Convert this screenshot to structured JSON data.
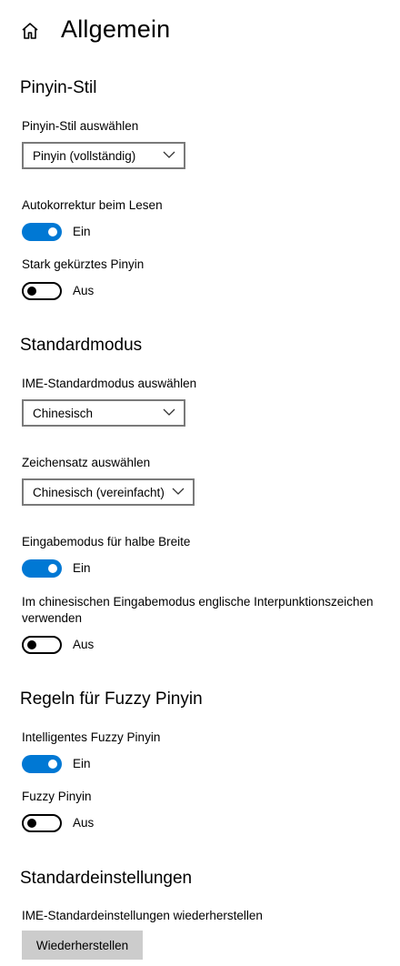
{
  "header": {
    "title": "Allgemein"
  },
  "sections": {
    "pinyin": {
      "heading": "Pinyin-Stil",
      "select_label": "Pinyin-Stil auswählen",
      "select_value": "Pinyin (vollständig)",
      "autocorrect_label": "Autokorrektur beim Lesen",
      "autocorrect_state": "Ein",
      "abbrev_label": "Stark gekürztes Pinyin",
      "abbrev_state": "Aus"
    },
    "standard": {
      "heading": "Standardmodus",
      "ime_label": "IME-Standardmodus auswählen",
      "ime_value": "Chinesisch",
      "charset_label": "Zeichensatz auswählen",
      "charset_value": "Chinesisch (vereinfacht)",
      "halfwidth_label": "Eingabemodus für halbe Breite",
      "halfwidth_state": "Ein",
      "punct_label_line1": "Im chinesischen Eingabemodus englische Interpunktionszeichen",
      "punct_label_line2": "verwenden",
      "punct_state": "Aus"
    },
    "fuzzy": {
      "heading": "Regeln für Fuzzy Pinyin",
      "smart_label": "Intelligentes Fuzzy Pinyin",
      "smart_state": "Ein",
      "fuzzy_label": "Fuzzy Pinyin",
      "fuzzy_state": "Aus"
    },
    "defaults": {
      "heading": "Standardeinstellungen",
      "reset_label": "IME-Standardeinstellungen wiederherstellen",
      "reset_button": "Wiederherstellen"
    }
  },
  "colors": {
    "accent": "#0078d4",
    "button_bg": "#cccccc",
    "border": "#7a7a7a"
  }
}
